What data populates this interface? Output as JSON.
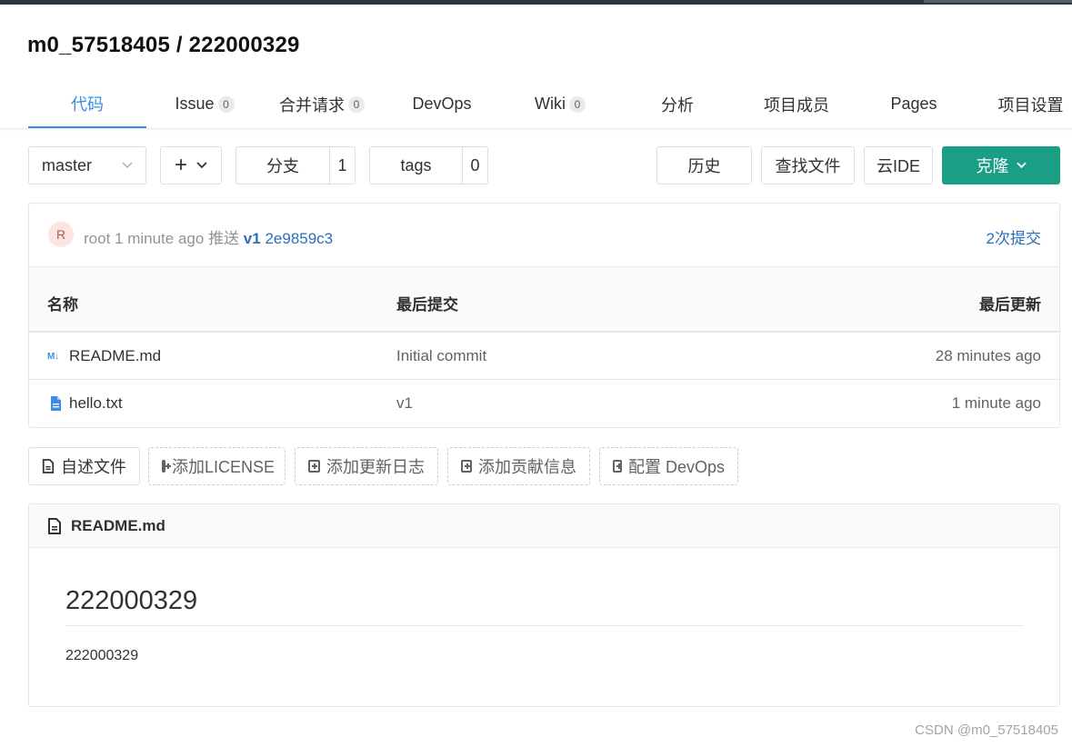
{
  "repo": {
    "title": "m0_57518405 / 222000329"
  },
  "tabs": [
    {
      "label": "代码",
      "badge": ""
    },
    {
      "label": "Issue",
      "badge": "0"
    },
    {
      "label": "合并请求",
      "badge": "0"
    },
    {
      "label": "DevOps",
      "badge": ""
    },
    {
      "label": "Wiki",
      "badge": "0"
    },
    {
      "label": "分析",
      "badge": ""
    },
    {
      "label": "项目成员",
      "badge": ""
    },
    {
      "label": "Pages",
      "badge": ""
    },
    {
      "label": "项目设置",
      "badge": ""
    }
  ],
  "toolbar": {
    "branch": "master",
    "add": "+",
    "branches_label": "分支",
    "branches_count": "1",
    "tags_label": "tags",
    "tags_count": "0",
    "history": "历史",
    "find_file": "查找文件",
    "cloud_ide": "云IDE",
    "clone": "克隆"
  },
  "commit": {
    "avatar": "R",
    "author": "root",
    "time": "1 minute ago",
    "action": "推送",
    "tag": "v1",
    "sha": "2e9859c3",
    "count_label": "2次提交"
  },
  "files": {
    "headers": {
      "name": "名称",
      "last_commit": "最后提交",
      "last_update": "最后更新"
    },
    "rows": [
      {
        "name": "README.md",
        "commit": "Initial commit",
        "updated": "28 minutes ago",
        "icon": "markdown-icon"
      },
      {
        "name": "hello.txt",
        "commit": "v1",
        "updated": "1 minute ago",
        "icon": "file-icon"
      }
    ]
  },
  "actions": {
    "readme": "自述文件",
    "license": "添加LICENSE",
    "changelog": "添加更新日志",
    "contrib": "添加贡献信息",
    "devops": "配置 DevOps"
  },
  "readme": {
    "file": "README.md",
    "heading": "222000329",
    "body": "222000329"
  },
  "watermark": "CSDN @m0_57518405",
  "colors": {
    "accent": "#3a8ee6",
    "primary": "#1a9f86",
    "link": "#2c6fb7"
  }
}
